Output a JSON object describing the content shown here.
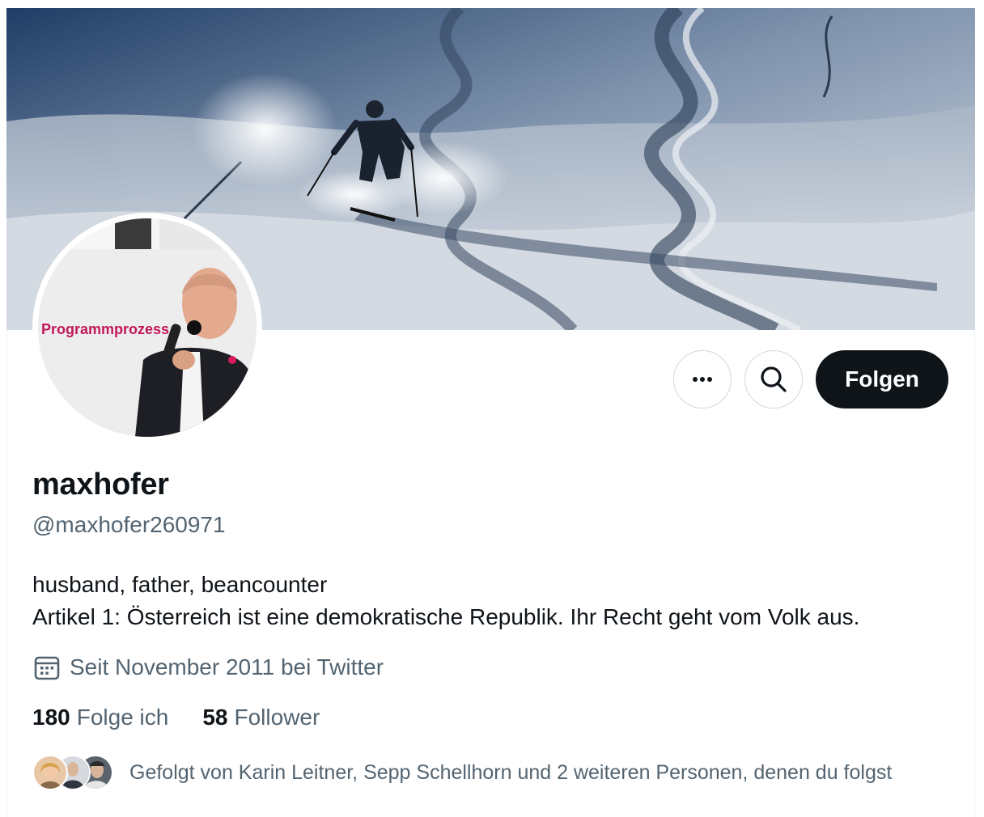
{
  "profile": {
    "display_name": "maxhofer",
    "handle": "@maxhofer260971",
    "bio_line1": "husband, father, beancounter",
    "bio_line2": "Artikel 1: Österreich ist eine demokratische Republik. Ihr Recht geht vom Volk aus.",
    "joined": "Seit November 2011 bei Twitter",
    "avatar_sign_text": "Programmprozess"
  },
  "actions": {
    "more_icon": "more-horizontal-icon",
    "search_icon": "search-icon",
    "follow_label": "Folgen"
  },
  "stats": {
    "following_count": "180",
    "following_label": "Folge ich",
    "followers_count": "58",
    "followers_label": "Follower"
  },
  "followed_by": {
    "text": "Gefolgt von Karin Leitner, Sepp Schellhorn und 2 weiteren Personen, denen du folgst"
  },
  "colors": {
    "text_primary": "#0f1419",
    "text_secondary": "#536471",
    "border": "#cfd9de",
    "follow_button_bg": "#0f1419"
  }
}
